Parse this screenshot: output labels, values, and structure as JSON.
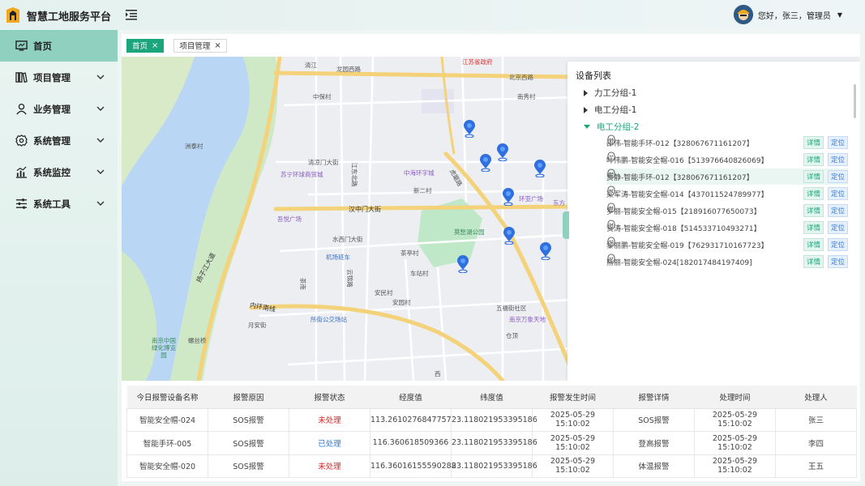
{
  "header": {
    "app_title": "智慧工地服务平台",
    "greeting": "您好，张三，管理员"
  },
  "sidebar": {
    "items": [
      {
        "label": "首页",
        "icon": "monitor-icon"
      },
      {
        "label": "项目管理",
        "icon": "books-icon"
      },
      {
        "label": "业务管理",
        "icon": "user-icon"
      },
      {
        "label": "系统管理",
        "icon": "gear-icon"
      },
      {
        "label": "系统监控",
        "icon": "chart-icon"
      },
      {
        "label": "系统工具",
        "icon": "sliders-icon"
      }
    ]
  },
  "tabs": [
    {
      "label": "首页",
      "active": true
    },
    {
      "label": "项目管理",
      "active": false
    }
  ],
  "map": {
    "labels": {
      "l0": "江苏省政府",
      "l1": "北京西路",
      "l2": "南秀村",
      "l3": "清江路",
      "l4": "龙园西路",
      "l5": "中保村",
      "l6": "洲泰村",
      "l7": "苏宁环球商贸城",
      "l8": "清凉门大街",
      "l9": "中海环宇城",
      "l10": "新二村",
      "l11": "环亚广场",
      "l12": "东方",
      "l13": "汉中门大街",
      "l14": "吾悦广场",
      "l15": "水西门大街",
      "l16": "莫愁湖公园",
      "l17": "机场班车",
      "l18": "茶亭村",
      "l19": "车站村",
      "l20": "扬子江大道",
      "l21": "内环南线",
      "l22": "所街公交场站",
      "l23": "安民村",
      "l24": "安园村",
      "l25": "五福街社区",
      "l26": "南京万象天地",
      "l27": "螺丝桥",
      "l28": "南京中国绿化博览园",
      "l29": "仓顶",
      "l30": "虎踞路",
      "l31": "茶南",
      "l32": "云锦路",
      "l33": "江东北路",
      "l34": "月安街",
      "l35": "西",
      "l36": "清江"
    }
  },
  "device_panel": {
    "title": "设备列表",
    "groups": [
      {
        "label": "力工分组-1",
        "open": false
      },
      {
        "label": "电工分组-1",
        "open": false
      },
      {
        "label": "电工分组-2",
        "open": true
      }
    ],
    "detail_label": "详情",
    "locate_label": "定位",
    "devices": [
      {
        "name": "邵伟-智能手环-012【328067671161207】"
      },
      {
        "name": "叶伟鹏-智能安全帽-016【513976640826069】"
      },
      {
        "name": "贾静-智能手环-012【328067671161207】"
      },
      {
        "name": "梁军涛-智能安全帽-014【437011524789977】"
      },
      {
        "name": "罗丽-智能安全帽-015【218916077650073】"
      },
      {
        "name": "贺涛-智能安全帽-018【514533710493271】"
      },
      {
        "name": "黎丽鹏-智能安全帽-019【762931710167723】"
      },
      {
        "name": "熊丽-智能安全帽-024[182017484197409]"
      }
    ]
  },
  "alarm_table": {
    "headers": [
      "今日报警设备名称",
      "报警原因",
      "报警状态",
      "经度值",
      "纬度值",
      "报警发生时间",
      "报警详情",
      "处理时间",
      "处理人"
    ],
    "rows": [
      [
        "智能安全帽-024",
        "SOS报警",
        "未处理",
        "113.2610276847757",
        "23.118021953395186",
        "2025-05-29 15:10:02",
        "SOS报警",
        "2025-05-29 15:10:02",
        "张三"
      ],
      [
        "智能手环-005",
        "SOS报警",
        "已处理",
        "116.360618509366",
        "23.118021953395186",
        "2025-05-29 15:10:02",
        "登高报警",
        "2025-05-29 15:10:02",
        "李四"
      ],
      [
        "智能安全帽-020",
        "SOS报警",
        "未处理",
        "116.36016155590288",
        "23.118021953395186",
        "2025-05-29 15:10:02",
        "体温报警",
        "2025-05-29 15:10:02",
        "王五"
      ]
    ],
    "status_colors": {
      "未处理": "#e02020",
      "已处理": "#2c7be5"
    }
  },
  "colors": {
    "accent": "#1aa57c",
    "sidebar_active": "#8fd1be",
    "river": "#b9d7f5",
    "park": "#bfe8c8"
  }
}
